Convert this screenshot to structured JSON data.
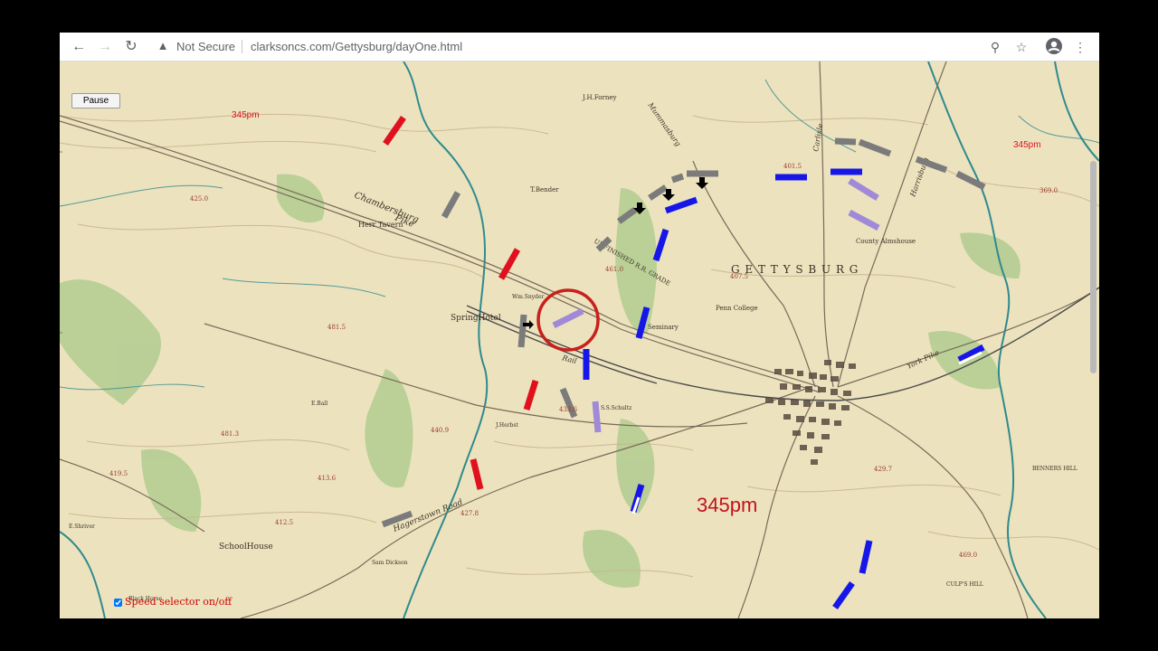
{
  "browser": {
    "security_label": "Not Secure",
    "url": "clarksoncs.com/Gettysburg/dayOne.html",
    "icons": {
      "back": "back-arrow-icon",
      "forward": "forward-arrow-icon",
      "reload": "reload-icon",
      "warning": "warning-triangle-icon",
      "zoom": "zoom-icon",
      "bookmark": "star-icon",
      "account": "account-circle-icon",
      "menu": "kebab-menu-icon"
    }
  },
  "controls": {
    "pause_label": "Pause",
    "speed_label": "Speed selector on/off",
    "speed_checked": true
  },
  "map": {
    "time_label_main": "345pm",
    "time_label_small_left": "345pm",
    "time_label_small_right": "345pm",
    "place_labels": {
      "gettysburg": "G E T T Y S B U R G",
      "chambersburg": "Chambersburg",
      "pike": "Pike",
      "unfinished_rr": "UNFINISHED R.R. GRADE",
      "spring_hotel": "SpringHotel",
      "herr_tavern": "Herr Tavern",
      "schoolhouse": "SchoolHouse",
      "county_almshouse": "County Almshouse",
      "penn_college": "Penn College",
      "seminary": "Seminary",
      "bender": "T.Bender",
      "forney": "J.H.Forney",
      "mummasburg": "Mummasburg",
      "carlisle": "Carlisle",
      "harrisburg": "Harrisburg",
      "york_pike": "York Pike",
      "benners_hill": "BENNERS HILL",
      "culps_hill": "CULP'S HILL",
      "hagerstown": "Hagerstown Road",
      "rail": "Rail",
      "snyder": "Wm.Snyder",
      "schultz": "S.S.Schultz",
      "herbst": "J.Herbst",
      "ball": "E.Ball",
      "dickson": "Sam Dickson",
      "shriver": "E.Shriver",
      "black_horse": "Black Horse"
    },
    "colors": {
      "confederate": "#e0101e",
      "union": "#1616e8",
      "union_light": "#a08ad8",
      "confederate_grey": "#7b7b7b",
      "target_circle": "#c8201c",
      "paper": "#ece2be",
      "river": "#2f8a8e",
      "woods": "#9ec17a"
    }
  }
}
